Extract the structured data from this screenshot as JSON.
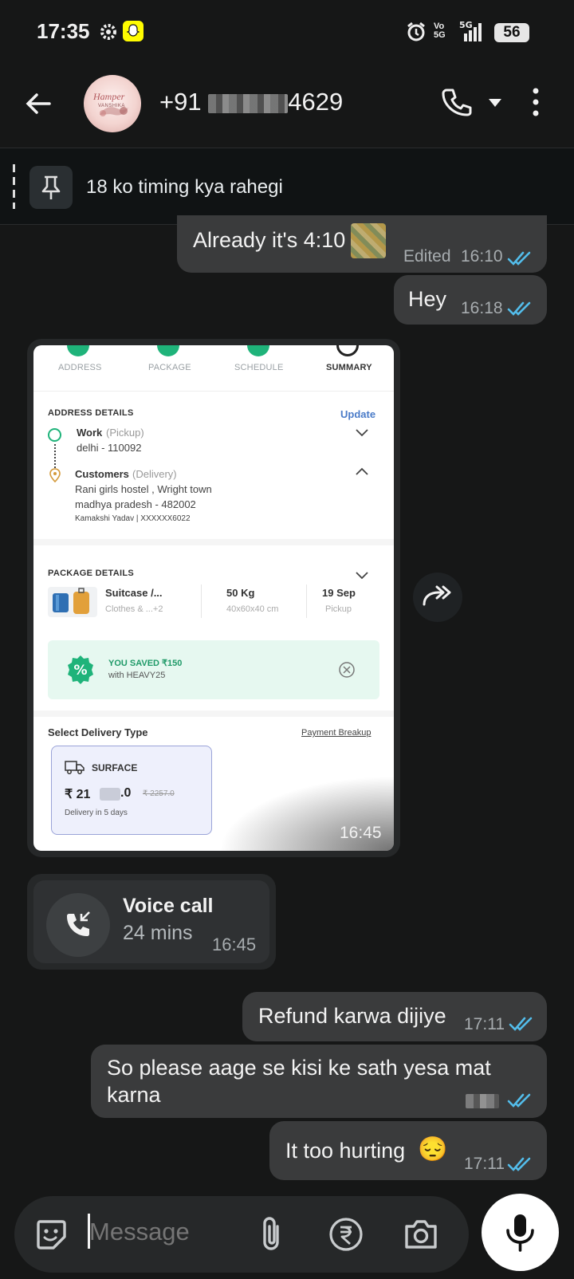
{
  "status_bar": {
    "time": "17:35",
    "battery": "56",
    "network_label": "5G",
    "volte_label": "Vo\n5G",
    "icons": [
      "gear-icon",
      "snapchat-icon",
      "alarm-icon",
      "volte-icon",
      "signal-icon",
      "battery-icon"
    ]
  },
  "header": {
    "contact_prefix": "+91",
    "contact_suffix": "4629",
    "avatar_text_top": "Hamper",
    "avatar_text_bottom": "VANSHIKA"
  },
  "pinned": {
    "text": "18 ko timing kya rahegi"
  },
  "messages": {
    "m1": {
      "text": "Already it's 4:10",
      "edited_label": "Edited",
      "time": "16:10"
    },
    "m2": {
      "text": "Hey",
      "time": "16:18"
    },
    "image_msg": {
      "time": "16:45"
    },
    "call": {
      "title": "Voice call",
      "duration": "24 mins",
      "time": "16:45"
    },
    "m3": {
      "text": "Refund karwa dijiye",
      "time": "17:11"
    },
    "m4": {
      "text": "So please aage se kisi ke sath yesa mat karna"
    },
    "m5": {
      "text": "It too hurting",
      "emoji": "😔",
      "time": "17:11"
    }
  },
  "screenshot": {
    "steps": [
      "ADDRESS",
      "PACKAGE",
      "SCHEDULE",
      "SUMMARY"
    ],
    "address_header": "ADDRESS DETAILS",
    "update_label": "Update",
    "pickup_title": "Work",
    "pickup_tag": "(Pickup)",
    "pickup_address": "delhi - 110092",
    "delivery_title": "Customers",
    "delivery_tag": "(Delivery)",
    "delivery_line1": "Rani girls hostel , Wright town",
    "delivery_line2": "madhya pradesh - 482002",
    "delivery_contact": "Kamakshi Yadav | XXXXXX6022",
    "package_header": "PACKAGE DETAILS",
    "pkg_name": "Suitcase /...",
    "pkg_sub": "Clothes & ...+2",
    "pkg_weight": "50 Kg",
    "pkg_dims": "40x60x40 cm",
    "pkg_date": "19 Sep",
    "pkg_date_sub": "Pickup",
    "saved_title": "YOU SAVED ₹150",
    "saved_sub": "with HEAVY25",
    "delivery_type_header": "Select Delivery Type",
    "payment_breakup": "Payment Breakup",
    "surface_label": "SURFACE",
    "price_prefix": "₹ 21",
    "price_suffix": ".0",
    "old_price": "₹ 2257.0",
    "delivery_eta": "Delivery in 5 days"
  },
  "composer": {
    "placeholder": "Message"
  },
  "colors": {
    "background": "#161717",
    "bubble_out": "#3a3b3c",
    "tick_blue": "#53bdeb",
    "accent_green": "#1fb37a"
  }
}
